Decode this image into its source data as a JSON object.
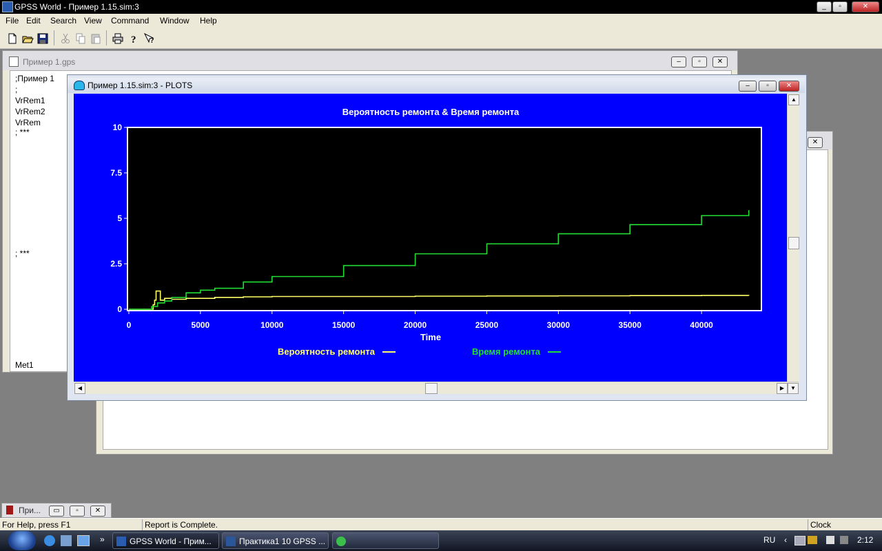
{
  "app": {
    "title": "GPSS World - Пример 1.15.sim:3"
  },
  "menu": [
    "File",
    "Edit",
    "Search",
    "View",
    "Command",
    "Window",
    "Help"
  ],
  "toolbar": {
    "buttons": [
      "new-file-icon",
      "open-folder-icon",
      "save-icon",
      "cut-icon",
      "copy-icon",
      "paste-icon",
      "print-icon",
      "help-icon",
      "context-help-icon"
    ]
  },
  "model_window": {
    "title": "Пример 1.gps",
    "lines": [
      ";Пример 1",
      ";",
      "VrRem1",
      "VrRem2",
      "VrRem",
      "; ***",
      "; ***",
      "Met1"
    ]
  },
  "plots_window": {
    "title": "Пример 1.15.sim:3  -  PLOTS"
  },
  "chart_data": {
    "type": "line",
    "title": "Вероятность ремонта & Время ремонта",
    "xlabel": "Time",
    "ylabel": "",
    "xlim": [
      0,
      43700
    ],
    "ylim": [
      0,
      10
    ],
    "xticks": [
      "0",
      "5000",
      "10000",
      "15000",
      "20000",
      "25000",
      "30000",
      "35000",
      "40000"
    ],
    "yticks": [
      "0",
      "2.5",
      "5",
      "7.5",
      "10"
    ],
    "background": "#000000",
    "plot_frame_color": "#0000ff",
    "series": [
      {
        "name": "Вероятность ремонта",
        "color": "#ffff66",
        "x": [
          0,
          1400,
          1700,
          1800,
          1900,
          2100,
          2200,
          2500,
          3000,
          4000,
          6000,
          8000,
          10000,
          15000,
          20000,
          25000,
          30000,
          35000,
          40000,
          43300
        ],
        "y": [
          0,
          0,
          0.25,
          0.5,
          1.0,
          1.0,
          0.5,
          0.6,
          0.55,
          0.6,
          0.65,
          0.68,
          0.7,
          0.7,
          0.72,
          0.73,
          0.74,
          0.75,
          0.76,
          0.75
        ]
      },
      {
        "name": "Время ремонта",
        "color": "#22dd33",
        "x": [
          0,
          1400,
          1600,
          2000,
          2500,
          3000,
          4000,
          5000,
          6000,
          8000,
          10000,
          15000,
          20000,
          25000,
          30000,
          35000,
          40000,
          43300
        ],
        "y": [
          0,
          0,
          0.15,
          0.35,
          0.45,
          0.65,
          0.9,
          1.05,
          1.15,
          1.5,
          1.8,
          2.4,
          3.05,
          3.6,
          4.15,
          4.65,
          5.15,
          5.45
        ]
      }
    ]
  },
  "minimized_window": {
    "title": "При..."
  },
  "status": {
    "help": "For Help, press F1",
    "report": "Report is Complete.",
    "clock": "Clock"
  },
  "taskbar": {
    "items": [
      "GPSS World - Прим...",
      "Практика1 10 GPSS ..."
    ],
    "lang": "RU",
    "time": "2:12"
  }
}
